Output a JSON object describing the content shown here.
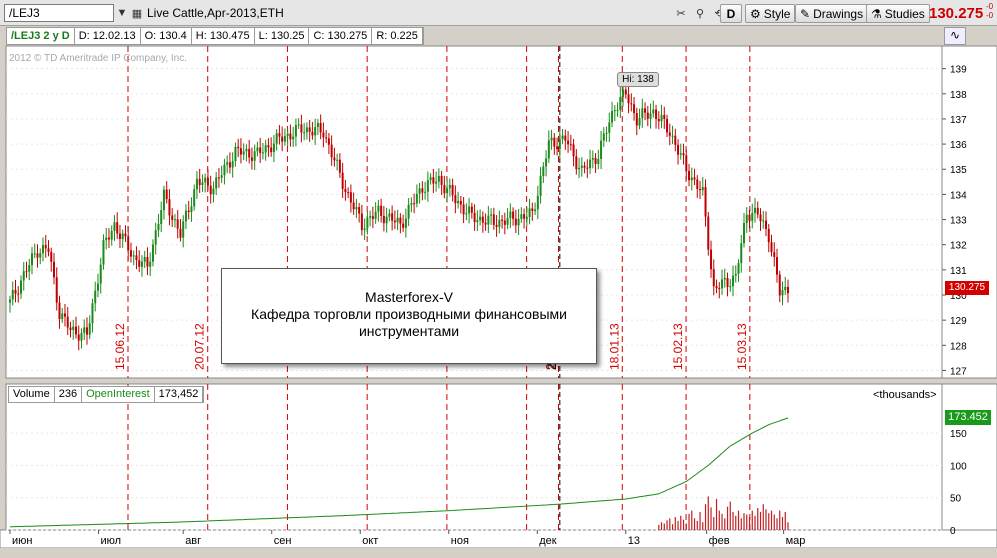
{
  "toolbar": {
    "symbol": "/LEJ3",
    "title": "Live Cattle,Apr-2013,ETH",
    "buttons": {
      "d": "D",
      "style": "Style",
      "drawings": "Drawings",
      "studies": "Studies"
    },
    "price": "130.275",
    "change_top": "-0",
    "change_bottom": "-0",
    "colors": {
      "price": "#cc0000"
    }
  },
  "info": {
    "symbol_period": "/LEJ3 2 y D",
    "date": "D: 12.02.13",
    "open": "O: 130.4",
    "high": "H: 130.475",
    "low": "L: 130.25",
    "close": "C: 130.275",
    "range": "R: 0.225"
  },
  "copyright": "2012 © TD Ameritrade IP Company, Inc.",
  "hi_label": "Hi: 138",
  "last_price_tag": "130.275",
  "message": {
    "line1": "Masterforex-V",
    "line2": "Кафедра торговли производными финансовыми",
    "line3": "инструментами"
  },
  "volume_header": {
    "volume_label": "Volume",
    "volume_value": "236",
    "oi_label": "OpenInterest",
    "oi_value": "173,452",
    "units": "<thousands>"
  },
  "oi_tag": "173.452",
  "chart_data": [
    {
      "type": "candlestick",
      "title": "",
      "ylim": [
        126.7,
        139.9
      ],
      "y_ticks": [
        127,
        128,
        129,
        130,
        131,
        132,
        133,
        134,
        135,
        136,
        137,
        138,
        139
      ],
      "x_ticks": [
        "июн",
        "июл",
        "авг",
        "сен",
        "окт",
        "ноя",
        "дек",
        "13",
        "фев",
        "мар"
      ],
      "year_marker": "2012 year",
      "grid": true,
      "vertical_markers": [
        "15.06.12",
        "20.07.12",
        "24.08.12",
        "28.09.12",
        "02.11.12",
        "07.12.12",
        "21.12.12",
        "18.01.13",
        "15.02.13",
        "15.03.13"
      ],
      "shown_marker_labels": [
        "15.06.12",
        "20.07.12",
        "21.12.12",
        "18.01.13",
        "15.02.13",
        "15.03.13"
      ],
      "anchors": [
        [
          0,
          129.7
        ],
        [
          5,
          130.8
        ],
        [
          10,
          131.8
        ],
        [
          14,
          131.8
        ],
        [
          18,
          129.3
        ],
        [
          22,
          128.6
        ],
        [
          28,
          128.4
        ],
        [
          34,
          131.9
        ],
        [
          38,
          132.8
        ],
        [
          45,
          131.5
        ],
        [
          50,
          131.1
        ],
        [
          56,
          133.9
        ],
        [
          62,
          132.4
        ],
        [
          68,
          134.5
        ],
        [
          74,
          134.3
        ],
        [
          82,
          135.7
        ],
        [
          90,
          135.6
        ],
        [
          98,
          136.2
        ],
        [
          106,
          136.6
        ],
        [
          114,
          136.5
        ],
        [
          122,
          134.2
        ],
        [
          128,
          132.8
        ],
        [
          134,
          133.3
        ],
        [
          142,
          132.8
        ],
        [
          150,
          134.3
        ],
        [
          156,
          134.6
        ],
        [
          162,
          133.8
        ],
        [
          168,
          133.1
        ],
        [
          176,
          132.9
        ],
        [
          182,
          133.0
        ],
        [
          190,
          133.2
        ],
        [
          196,
          136.0
        ],
        [
          202,
          136.2
        ],
        [
          208,
          134.9
        ],
        [
          214,
          135.6
        ],
        [
          220,
          137.5
        ],
        [
          224,
          138.0
        ],
        [
          228,
          137.0
        ],
        [
          234,
          137.3
        ],
        [
          240,
          136.5
        ],
        [
          246,
          135.0
        ],
        [
          252,
          134.0
        ],
        [
          256,
          130.2
        ],
        [
          260,
          130.5
        ],
        [
          264,
          130.7
        ],
        [
          268,
          133.3
        ],
        [
          272,
          133.2
        ],
        [
          276,
          132.4
        ],
        [
          280,
          130.1
        ],
        [
          283,
          130.275
        ]
      ],
      "bar_count": 284
    },
    {
      "type": "bar+line",
      "series": [
        {
          "name": "Volume",
          "last": 236
        },
        {
          "name": "OpenInterest",
          "last": 173.452
        }
      ],
      "units": "thousands",
      "ylim": [
        0,
        195
      ],
      "y_ticks": [
        0,
        50,
        100,
        150
      ],
      "oi_anchors": [
        [
          0,
          5
        ],
        [
          60,
          12
        ],
        [
          120,
          22
        ],
        [
          160,
          30
        ],
        [
          200,
          40
        ],
        [
          224,
          48
        ],
        [
          236,
          56
        ],
        [
          246,
          75
        ],
        [
          254,
          100
        ],
        [
          262,
          130
        ],
        [
          270,
          150
        ],
        [
          276,
          163
        ],
        [
          283,
          173.452
        ]
      ],
      "volume_start_index": 236,
      "volume_values": [
        8,
        12,
        10,
        15,
        18,
        9,
        20,
        14,
        22,
        16,
        10,
        25,
        30,
        18,
        14,
        28,
        12,
        40,
        52,
        35,
        20,
        48,
        30,
        25,
        18,
        36,
        44,
        28,
        22,
        30,
        18,
        26,
        24,
        20,
        30,
        22,
        34,
        28,
        40,
        32,
        26,
        30,
        24,
        18,
        30,
        20,
        28,
        12
      ]
    }
  ],
  "colors": {
    "up": "#1a8a1a",
    "down": "#c00000",
    "marker": "#d40000",
    "oi_line": "#1a8a1a",
    "volume": "#c02020"
  }
}
